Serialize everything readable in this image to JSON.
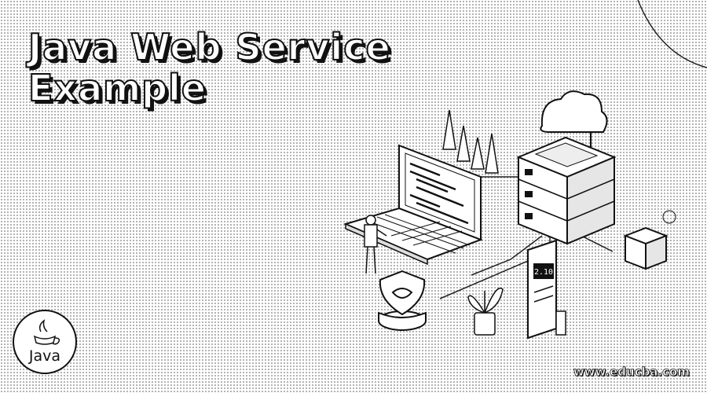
{
  "title": {
    "line1": "Java Web Service",
    "line2": "Example"
  },
  "logo": {
    "label": "Java"
  },
  "watermark": {
    "text": "www.educba.com"
  },
  "illustration": {
    "screen_code": "2.10",
    "icons": [
      "laptop-icon",
      "server-rack-icon",
      "cloud-icon",
      "phone-icon",
      "shield-icon",
      "router-icon",
      "plant-icon",
      "person-icon",
      "tree-icon"
    ]
  }
}
